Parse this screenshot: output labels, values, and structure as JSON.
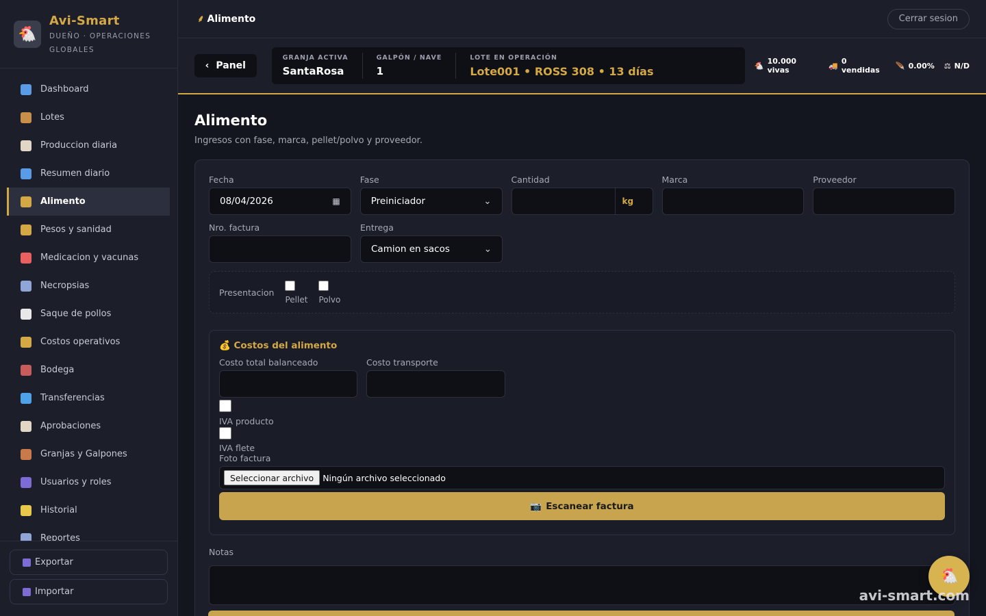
{
  "brand": {
    "name": "Avi-Smart",
    "subtitle": "DUEÑO · OPERACIONES GLOBALES"
  },
  "sidebar": {
    "items": [
      {
        "label": "Dashboard",
        "icon": "chart-icon",
        "color": "#5a9be8"
      },
      {
        "label": "Lotes",
        "icon": "box-icon",
        "color": "#c88f4a"
      },
      {
        "label": "Produccion diaria",
        "icon": "clipboard-icon",
        "color": "#e2d7c6"
      },
      {
        "label": "Resumen diario",
        "icon": "chart-icon",
        "color": "#5a9be8"
      },
      {
        "label": "Alimento",
        "icon": "wheat-icon",
        "color": "#d4a845",
        "active": true
      },
      {
        "label": "Pesos y sanidad",
        "icon": "scale-icon",
        "color": "#d4a845"
      },
      {
        "label": "Medicacion y vacunas",
        "icon": "pill-icon",
        "color": "#e86060"
      },
      {
        "label": "Necropsias",
        "icon": "microscope-icon",
        "color": "#8fa6d6"
      },
      {
        "label": "Saque de pollos",
        "icon": "chicken-icon",
        "color": "#e8e8e8"
      },
      {
        "label": "Costos operativos",
        "icon": "money-bag-icon",
        "color": "#d4a845"
      },
      {
        "label": "Bodega",
        "icon": "warehouse-icon",
        "color": "#c85b5b"
      },
      {
        "label": "Transferencias",
        "icon": "transfer-icon",
        "color": "#4ea3e8"
      },
      {
        "label": "Aprobaciones",
        "icon": "clipboard-icon",
        "color": "#e2d7c6"
      },
      {
        "label": "Granjas y Galpones",
        "icon": "barn-icon",
        "color": "#c87a4a"
      },
      {
        "label": "Usuarios y roles",
        "icon": "users-icon",
        "color": "#7d6bd6"
      },
      {
        "label": "Historial",
        "icon": "folder-icon",
        "color": "#e8c94a"
      },
      {
        "label": "Reportes",
        "icon": "chart-line-icon",
        "color": "#8fa6d6"
      }
    ],
    "export_label": "Exportar",
    "import_label": "Importar"
  },
  "topbar": {
    "title": "Alimento",
    "logout_label": "Cerrar sesion"
  },
  "context": {
    "back_label": "Panel",
    "farm_label": "GRANJA ACTIVA",
    "farm_value": "SantaRosa",
    "shed_label": "GALPÓN / NAVE",
    "shed_value": "1",
    "lot_label": "LOTE EN OPERACIÓN",
    "lot_value": "Lote001 • ROSS 308 • 13 días",
    "stats": [
      {
        "icon": "chicken-icon",
        "label": "10.000 vivas"
      },
      {
        "icon": "truck-icon",
        "label": "0 vendidas"
      },
      {
        "icon": "feather-icon",
        "label": "0.00%"
      },
      {
        "icon": "scale-icon",
        "label": "N/D"
      }
    ]
  },
  "page": {
    "title": "Alimento",
    "subtitle": "Ingresos con fase, marca, pellet/polvo y proveedor."
  },
  "form": {
    "fecha_label": "Fecha",
    "fecha_value": "08/04/2026",
    "fase_label": "Fase",
    "fase_value": "Preiniciador",
    "cantidad_label": "Cantidad",
    "cantidad_unit": "kg",
    "marca_label": "Marca",
    "proveedor_label": "Proveedor",
    "factura_label": "Nro. factura",
    "entrega_label": "Entrega",
    "entrega_value": "Camion en sacos",
    "presentacion_label": "Presentacion",
    "pellet_label": "Pellet",
    "polvo_label": "Polvo",
    "costs": {
      "title": "Costos del alimento",
      "total_label": "Costo total balanceado",
      "transporte_label": "Costo transporte",
      "iva_producto_label": "IVA producto",
      "iva_flete_label": "IVA flete",
      "foto_label": "Foto factura",
      "file_button": "Seleccionar archivo",
      "file_status": "Ningún archivo seleccionado",
      "scan_label": "Escanear factura"
    },
    "notas_label": "Notas"
  },
  "watermark": "avi-smart.com"
}
